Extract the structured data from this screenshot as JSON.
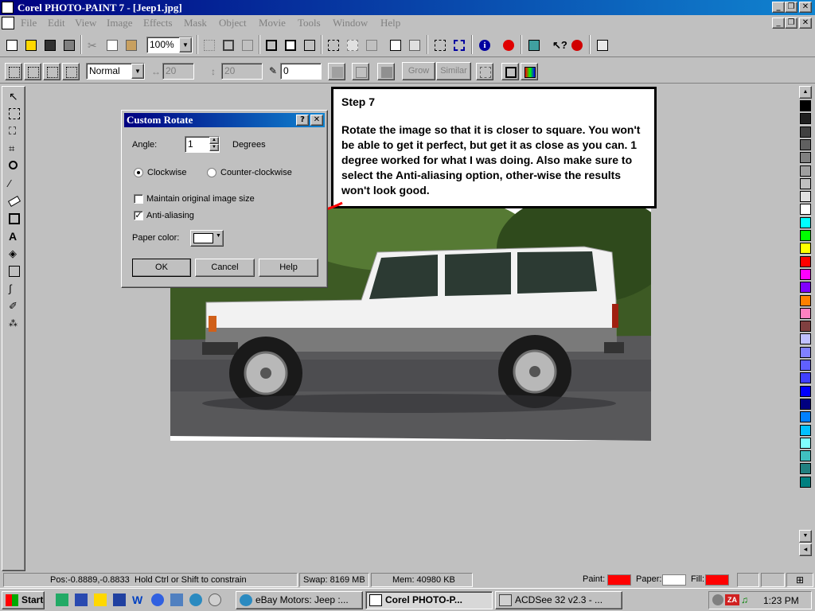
{
  "window": {
    "title": "Corel PHOTO-PAINT 7 - [Jeep1.jpg]",
    "minimize": "_",
    "restore": "❐",
    "close": "✕"
  },
  "menu": [
    "File",
    "Edit",
    "View",
    "Image",
    "Effects",
    "Mask",
    "Object",
    "Movie",
    "Tools",
    "Window",
    "Help"
  ],
  "toolbar": {
    "zoom": "100%"
  },
  "property_bar": {
    "merge_mode": "Normal",
    "width_value": "20",
    "height_value": "20",
    "tolerance_value": "0",
    "grow_label": "Grow",
    "similar_label": "Similar"
  },
  "dialog": {
    "title": "Custom Rotate",
    "help_glyph": "?",
    "close_glyph": "✕",
    "angle_label": "Angle:",
    "angle_value": "1",
    "degrees_label": "Degrees",
    "clockwise_label": "Clockwise",
    "counterclockwise_label": "Counter-clockwise",
    "direction_selected": "clockwise",
    "maintain_label": "Maintain original image size",
    "maintain_checked": false,
    "antialiasing_label": "Anti-aliasing",
    "antialiasing_checked": true,
    "paper_color_label": "Paper color:",
    "ok_label": "OK",
    "cancel_label": "Cancel",
    "help_label": "Help"
  },
  "callout": {
    "title": "Step 7",
    "body": "Rotate the image so that it is closer to square.  You won't be able to get it perfect, but get it as close as you can. 1 degree worked for what I was doing. Also make sure to select the Anti-aliasing option, other-wise the results won't look good."
  },
  "palette": [
    "#000000",
    "#202020",
    "#404040",
    "#606060",
    "#808080",
    "#a0a0a0",
    "#c0c0c0",
    "#e0e0e0",
    "#ffffff",
    "#00ffff",
    "#00ff00",
    "#ffff00",
    "#ff0000",
    "#ff00ff",
    "#8000ff",
    "#ff8000",
    "#ff80c0",
    "#804040",
    "#c0c0ff",
    "#8080ff",
    "#6060ff",
    "#4040ff",
    "#0000ff",
    "#000080",
    "#0080ff",
    "#00c0ff",
    "#80ffff",
    "#40c0c0",
    "#208080",
    "#008080"
  ],
  "status": {
    "pos": "Pos:-0.8889,-0.8833",
    "hint": "Hold Ctrl or Shift to constrain",
    "swap": "Swap: 8169 MB",
    "mem": "Mem: 40980 KB",
    "paint_label": "Paint:",
    "paint_color": "#ff0000",
    "paper_label": "Paper:",
    "paper_color": "#ffffff",
    "fill_label": "Fill:",
    "fill_color": "#ff0000"
  },
  "taskbar": {
    "start_label": "Start",
    "tasks": [
      "eBay Motors: Jeep :...",
      "Corel PHOTO-P...",
      "ACDSee 32 v2.3 - ..."
    ],
    "clock": "1:23 PM"
  },
  "icons": {
    "annotation_arrow_color": "#ff0000"
  }
}
